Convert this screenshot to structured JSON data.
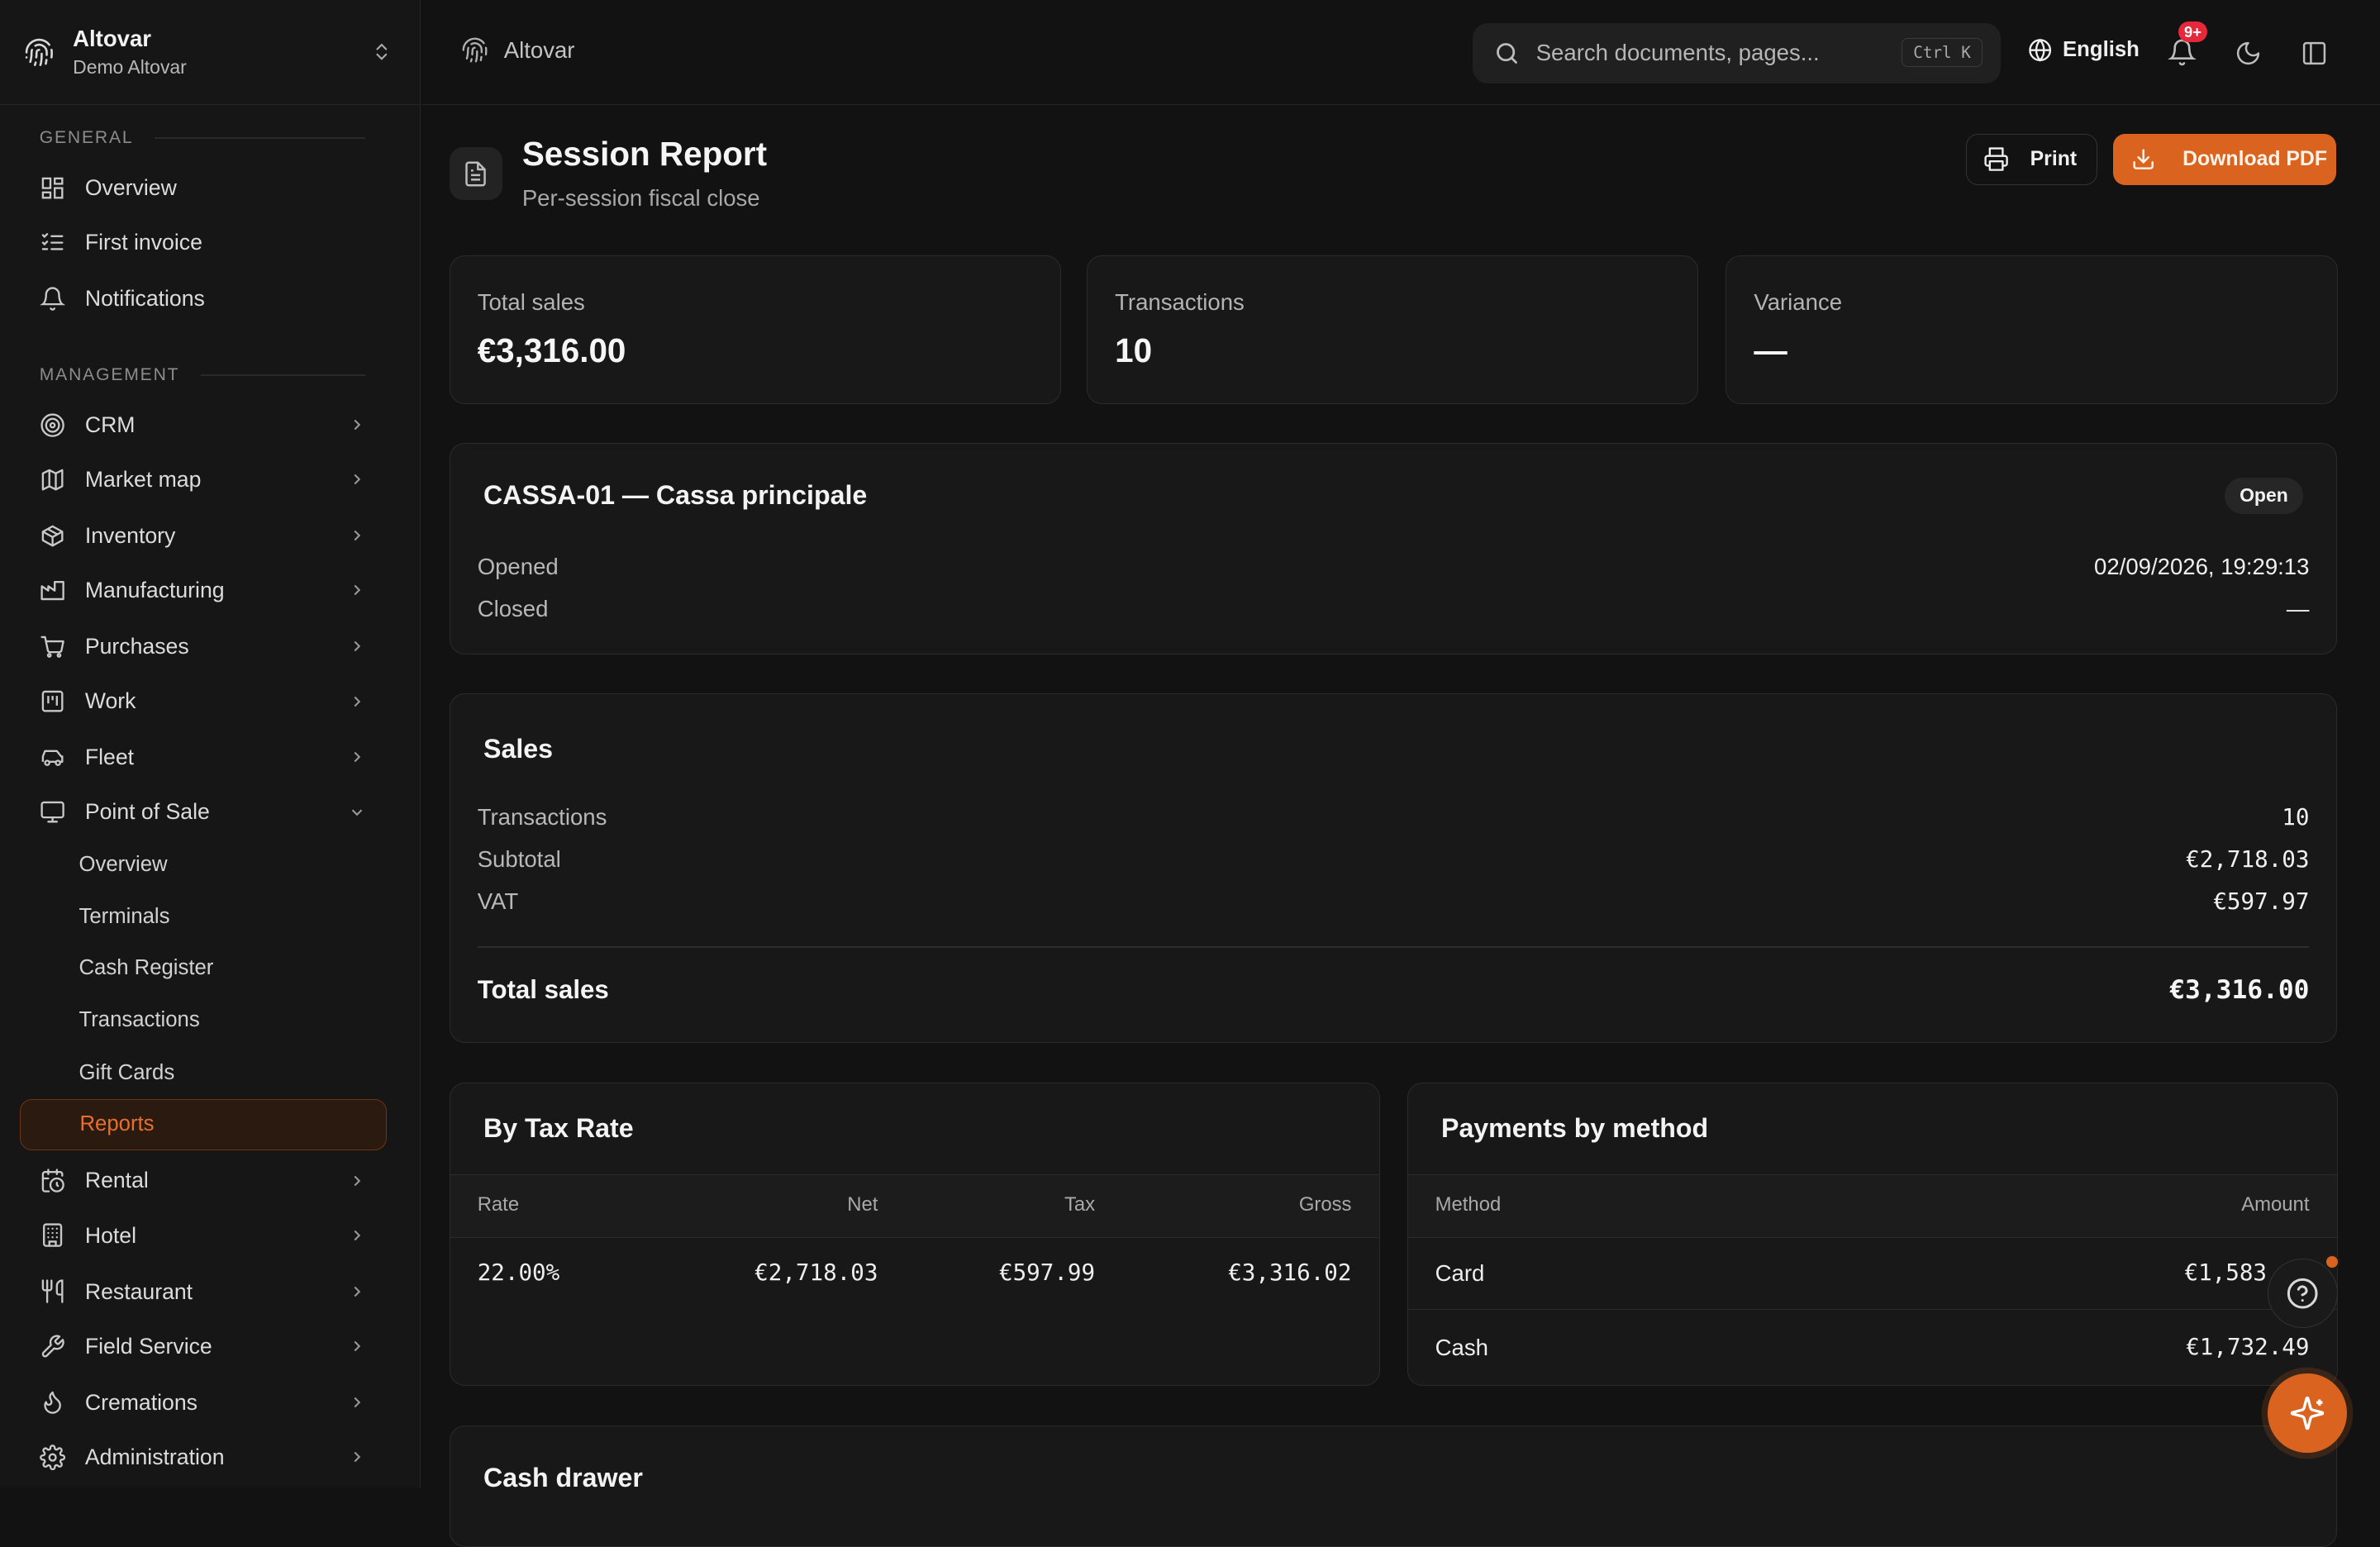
{
  "org": {
    "name": "Altovar",
    "sub": "Demo Altovar"
  },
  "sidebar": {
    "general_label": "GENERAL",
    "general": [
      {
        "label": "Overview",
        "icon": "dashboard-icon"
      },
      {
        "label": "First invoice",
        "icon": "checklist-icon"
      },
      {
        "label": "Notifications",
        "icon": "bell-icon"
      }
    ],
    "management_label": "MANAGEMENT",
    "management": [
      {
        "label": "CRM",
        "icon": "target-icon"
      },
      {
        "label": "Market map",
        "icon": "map-icon"
      },
      {
        "label": "Inventory",
        "icon": "package-icon"
      },
      {
        "label": "Manufacturing",
        "icon": "factory-icon"
      },
      {
        "label": "Purchases",
        "icon": "cart-icon"
      },
      {
        "label": "Work",
        "icon": "kanban-icon"
      },
      {
        "label": "Fleet",
        "icon": "car-icon"
      },
      {
        "label": "Point of Sale",
        "icon": "monitor-icon"
      }
    ],
    "pos_sub": [
      "Overview",
      "Terminals",
      "Cash Register",
      "Transactions",
      "Gift Cards",
      "Reports"
    ],
    "management_after": [
      {
        "label": "Rental",
        "icon": "calendar-clock-icon"
      },
      {
        "label": "Hotel",
        "icon": "building-icon"
      },
      {
        "label": "Restaurant",
        "icon": "utensils-icon"
      },
      {
        "label": "Field Service",
        "icon": "wrench-icon"
      },
      {
        "label": "Cremations",
        "icon": "flame-icon"
      },
      {
        "label": "Administration",
        "icon": "settings-icon"
      }
    ]
  },
  "topbar": {
    "breadcrumb": "Altovar",
    "search_placeholder": "Search documents, pages...",
    "search_shortcut": "Ctrl K",
    "language": "English",
    "notif_badge": "9+"
  },
  "page": {
    "title": "Session Report",
    "subtitle": "Per-session fiscal close",
    "print_label": "Print",
    "download_label": "Download PDF"
  },
  "stats": [
    {
      "label": "Total sales",
      "value": "€3,316.00"
    },
    {
      "label": "Transactions",
      "value": "10"
    },
    {
      "label": "Variance",
      "value": "—"
    }
  ],
  "session": {
    "title": "CASSA-01 — Cassa principale",
    "status": "Open",
    "opened_label": "Opened",
    "opened_value": "02/09/2026, 19:29:13",
    "closed_label": "Closed",
    "closed_value": "—"
  },
  "sales": {
    "title": "Sales",
    "rows": [
      {
        "label": "Transactions",
        "value": "10"
      },
      {
        "label": "Subtotal",
        "value": "€2,718.03"
      },
      {
        "label": "VAT",
        "value": "€597.97"
      }
    ],
    "total_label": "Total sales",
    "total_value": "€3,316.00"
  },
  "tax": {
    "title": "By Tax Rate",
    "headers": [
      "Rate",
      "Net",
      "Tax",
      "Gross"
    ],
    "rows": [
      [
        "22.00%",
        "€2,718.03",
        "€597.99",
        "€3,316.02"
      ]
    ]
  },
  "payments": {
    "title": "Payments by method",
    "headers": [
      "Method",
      "Amount"
    ],
    "rows": [
      [
        "Card",
        "€1,583"
      ],
      [
        "Cash",
        "€1,732.49"
      ]
    ]
  },
  "cash_drawer": {
    "title": "Cash drawer"
  },
  "colors": {
    "accent": "#d9631f",
    "background": "#121212",
    "card": "#181818",
    "badge": "#e5283b"
  }
}
